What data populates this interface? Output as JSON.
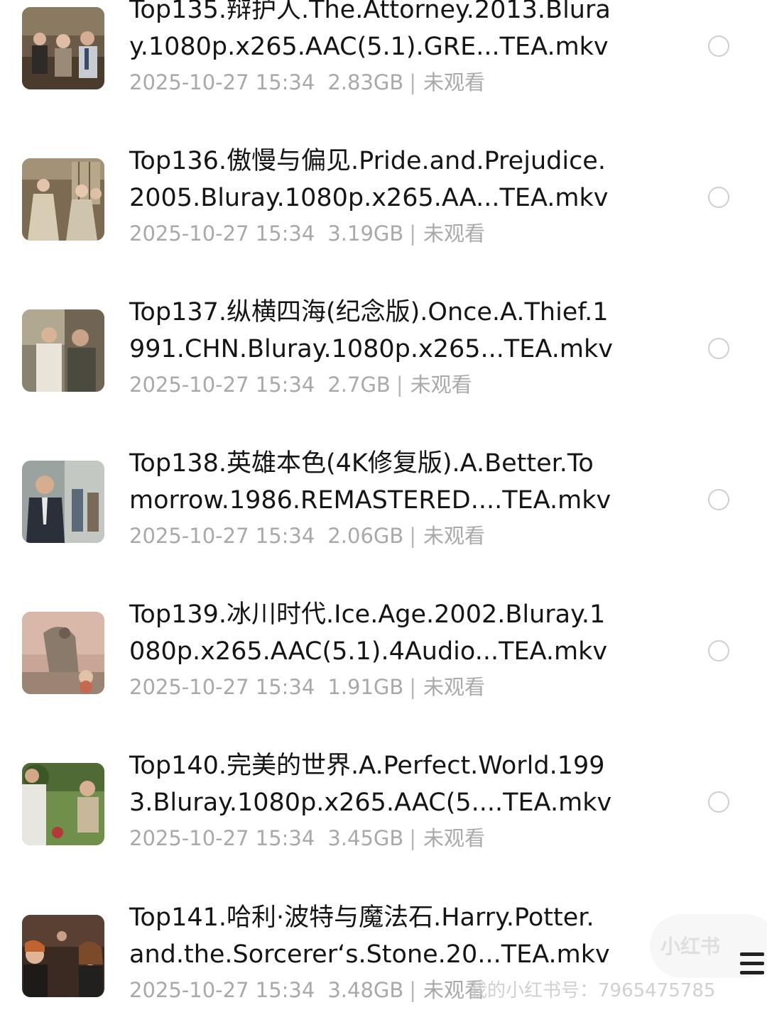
{
  "items": [
    {
      "title_line1": "Top135.辩护人.The.Attorney.2013.Blura",
      "title_line2": "y.1080p.x265.AAC(5.1).GRE...TEA.mkv",
      "date": "2025-10-27 15:34",
      "size": "2.83GB",
      "status": "未观看",
      "thumb": "courtroom-scene"
    },
    {
      "title_line1": "Top136.傲慢与偏见.Pride.and.Prejudice.",
      "title_line2": "2005.Bluray.1080p.x265.AA...TEA.mkv",
      "date": "2025-10-27 15:34",
      "size": "3.19GB",
      "status": "未观看",
      "thumb": "period-drama-scene"
    },
    {
      "title_line1": "Top137.纵横四海(纪念版).Once.A.Thief.1",
      "title_line2": "991.CHN.Bluray.1080p.x265...TEA.mkv",
      "date": "2025-10-27 15:34",
      "size": "2.7GB",
      "status": "未观看",
      "thumb": "two-men-scene"
    },
    {
      "title_line1": "Top138.英雄本色(4K修复版).A.Better.To",
      "title_line2": "morrow.1986.REMASTERED....TEA.mkv",
      "date": "2025-10-27 15:34",
      "size": "2.06GB",
      "status": "未观看",
      "thumb": "suit-man-scene"
    },
    {
      "title_line1": "Top139.冰川时代.Ice.Age.2002.Bluray.1",
      "title_line2": "080p.x265.AAC(5.1).4Audio...TEA.mkv",
      "date": "2025-10-27 15:34",
      "size": "1.91GB",
      "status": "未观看",
      "thumb": "animated-scene"
    },
    {
      "title_line1": "Top140.完美的世界.A.Perfect.World.199",
      "title_line2": "3.Bluray.1080p.x265.AAC(5....TEA.mkv",
      "date": "2025-10-27 15:34",
      "size": "3.45GB",
      "status": "未观看",
      "thumb": "grass-field-scene"
    },
    {
      "title_line1": "Top141.哈利·波特与魔法石.Harry.Potter.",
      "title_line2": "and.the.Sorcerer‘s.Stone.20...TEA.mkv",
      "date": "2025-10-27 15:34",
      "size": "3.48GB",
      "status": "未观看",
      "thumb": "classroom-scene"
    }
  ],
  "watermark": {
    "logo": "小红书",
    "id_text": "我的小红书号：7965475785"
  },
  "menu_icon": "hamburger-menu-icon"
}
